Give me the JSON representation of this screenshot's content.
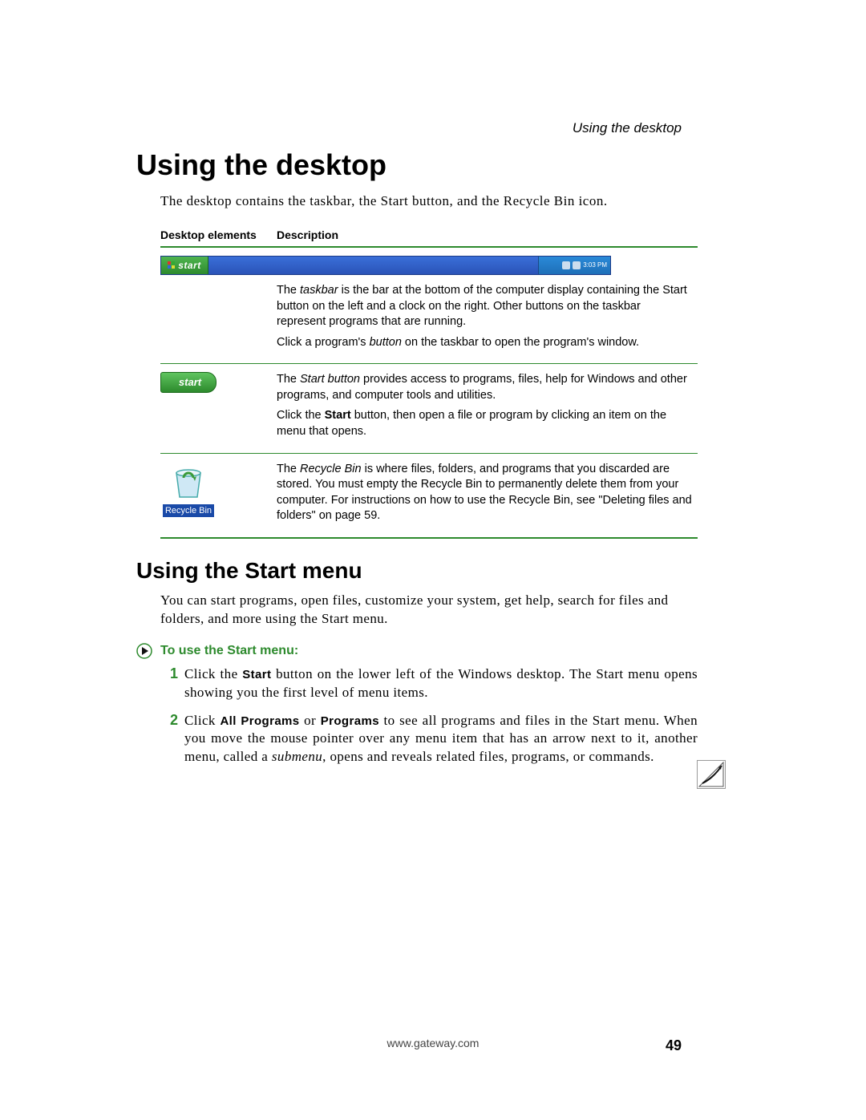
{
  "running_head": "Using the desktop",
  "heading1": "Using the desktop",
  "intro1": "The desktop contains the taskbar, the Start button, and the Recycle Bin icon.",
  "table": {
    "col1_header": "Desktop elements",
    "col2_header": "Description",
    "taskbar": {
      "start_label": "start",
      "tray_time": "3:03 PM"
    },
    "row1": {
      "desc_p1_a": "The ",
      "desc_p1_b_it": "taskbar",
      "desc_p1_c": " is the bar at the bottom of the computer display containing the Start button on the left and a clock on the right. Other buttons on the taskbar represent programs that are running.",
      "desc_p2_a": "Click a program's ",
      "desc_p2_b_it": "button",
      "desc_p2_c": " on the taskbar to open the program's window."
    },
    "row2": {
      "start_label": "start",
      "desc_p1_a": "The ",
      "desc_p1_b_it": "Start button",
      "desc_p1_c": " provides access to programs, files, help for Windows and other programs, and computer tools and utilities.",
      "desc_p2_a": "Click the ",
      "desc_p2_b_bold": "Start",
      "desc_p2_c": " button, then open a file or program by clicking an item on the menu that opens."
    },
    "row3": {
      "bin_label": "Recycle Bin",
      "desc_a": "The ",
      "desc_b_it": "Recycle Bin",
      "desc_c": " is where files, folders, and programs that you discarded are stored. You must empty the Recycle Bin to permanently delete them from your computer. For instructions on how to use the Recycle Bin, see \"Deleting files and folders\" on page 59."
    }
  },
  "heading2": "Using the Start menu",
  "intro2": "You can start programs, open files, customize your system, get help, search for files and folders, and more using the Start menu.",
  "proc_heading": "To use the Start menu:",
  "steps": [
    {
      "num": "1",
      "a": "Click the ",
      "b_bold": "Start",
      "c": " button on the lower left of the Windows desktop. The Start menu opens showing you the first level of menu items."
    },
    {
      "num": "2",
      "a": "Click ",
      "b_bold": "All Programs",
      "c": " or ",
      "d_bold": "Programs",
      "e": " to see all programs and files in the Start menu. When you move the mouse pointer over any menu item that has an arrow next to it, another menu, called a ",
      "f_it": "submenu",
      "g": ", opens and reveals related files, programs, or commands."
    }
  ],
  "footer_url": "www.gateway.com",
  "page_number": "49"
}
